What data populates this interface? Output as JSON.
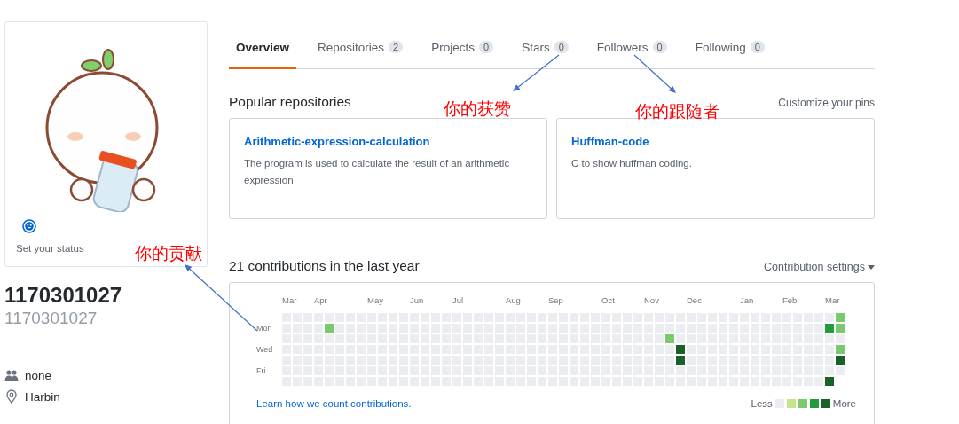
{
  "profile": {
    "status": "Set your status",
    "name": "1170301027",
    "login": "1170301027",
    "details": [
      {
        "kind": "organization",
        "text": "none"
      },
      {
        "kind": "location",
        "text": "Harbin"
      }
    ]
  },
  "tabs": [
    {
      "label": "Overview",
      "selected": true
    },
    {
      "label": "Repositories",
      "count": "2",
      "selected": false
    },
    {
      "label": "Projects",
      "count": "0",
      "selected": false
    },
    {
      "label": "Stars",
      "count": "0",
      "selected": false
    },
    {
      "label": "Followers",
      "count": "0",
      "selected": false
    },
    {
      "label": "Following",
      "count": "0",
      "selected": false
    }
  ],
  "popular": {
    "title": "Popular repositories",
    "action": "Customize your pins",
    "repos": [
      {
        "name": "Arithmetic-expression-calculation",
        "description": "The program is used to calculate the result of an arithmetic expression"
      },
      {
        "name": "Huffman-code",
        "description": "C to show huffman coding."
      }
    ]
  },
  "contributions": {
    "title": "21 contributions in the last year",
    "settings": "Contribution settings",
    "day_labels": [
      "Mon",
      "Wed",
      "Fri"
    ],
    "weeks": [
      {
        "month": "Mar",
        "days": [
          {
            "color": "#ebedf0"
          },
          {
            "color": "#ebedf0"
          },
          {
            "color": "#ebedf0"
          },
          {
            "color": "#ebedf0"
          },
          {
            "color": "#ebedf0"
          },
          {
            "color": "#ebedf0"
          },
          {
            "color": "#ebedf0"
          }
        ]
      },
      {
        "days": [
          {
            "color": "#ebedf0"
          },
          {
            "color": "#ebedf0"
          },
          {
            "color": "#ebedf0"
          },
          {
            "color": "#ebedf0"
          },
          {
            "color": "#ebedf0"
          },
          {
            "color": "#ebedf0"
          },
          {
            "color": "#ebedf0"
          }
        ]
      },
      {
        "days": [
          {
            "color": "#ebedf0"
          },
          {
            "color": "#ebedf0"
          },
          {
            "color": "#ebedf0"
          },
          {
            "color": "#ebedf0"
          },
          {
            "color": "#ebedf0"
          },
          {
            "color": "#ebedf0"
          },
          {
            "color": "#ebedf0"
          }
        ]
      },
      {
        "month": "Apr",
        "days": [
          {
            "color": "#ebedf0"
          },
          {
            "color": "#ebedf0"
          },
          {
            "color": "#ebedf0"
          },
          {
            "color": "#ebedf0"
          },
          {
            "color": "#ebedf0"
          },
          {
            "color": "#ebedf0"
          },
          {
            "color": "#ebedf0"
          }
        ]
      },
      {
        "days": [
          {
            "color": "#ebedf0"
          },
          {
            "color": "#7bc96f"
          },
          {
            "color": "#ebedf0"
          },
          {
            "color": "#ebedf0"
          },
          {
            "color": "#ebedf0"
          },
          {
            "color": "#ebedf0"
          },
          {
            "color": "#ebedf0"
          }
        ]
      },
      {
        "days": [
          {
            "color": "#ebedf0"
          },
          {
            "color": "#ebedf0"
          },
          {
            "color": "#ebedf0"
          },
          {
            "color": "#ebedf0"
          },
          {
            "color": "#ebedf0"
          },
          {
            "color": "#ebedf0"
          },
          {
            "color": "#ebedf0"
          }
        ]
      },
      {
        "days": [
          {
            "color": "#ebedf0"
          },
          {
            "color": "#ebedf0"
          },
          {
            "color": "#ebedf0"
          },
          {
            "color": "#ebedf0"
          },
          {
            "color": "#ebedf0"
          },
          {
            "color": "#ebedf0"
          },
          {
            "color": "#ebedf0"
          }
        ]
      },
      {
        "days": [
          {
            "color": "#ebedf0"
          },
          {
            "color": "#ebedf0"
          },
          {
            "color": "#ebedf0"
          },
          {
            "color": "#ebedf0"
          },
          {
            "color": "#ebedf0"
          },
          {
            "color": "#ebedf0"
          },
          {
            "color": "#ebedf0"
          }
        ]
      },
      {
        "month": "May",
        "days": [
          {
            "color": "#ebedf0"
          },
          {
            "color": "#ebedf0"
          },
          {
            "color": "#ebedf0"
          },
          {
            "color": "#ebedf0"
          },
          {
            "color": "#ebedf0"
          },
          {
            "color": "#ebedf0"
          },
          {
            "color": "#ebedf0"
          }
        ]
      },
      {
        "days": [
          {
            "color": "#ebedf0"
          },
          {
            "color": "#ebedf0"
          },
          {
            "color": "#ebedf0"
          },
          {
            "color": "#ebedf0"
          },
          {
            "color": "#ebedf0"
          },
          {
            "color": "#ebedf0"
          },
          {
            "color": "#ebedf0"
          }
        ]
      },
      {
        "days": [
          {
            "color": "#ebedf0"
          },
          {
            "color": "#ebedf0"
          },
          {
            "color": "#ebedf0"
          },
          {
            "color": "#ebedf0"
          },
          {
            "color": "#ebedf0"
          },
          {
            "color": "#ebedf0"
          },
          {
            "color": "#ebedf0"
          }
        ]
      },
      {
        "days": [
          {
            "color": "#ebedf0"
          },
          {
            "color": "#ebedf0"
          },
          {
            "color": "#ebedf0"
          },
          {
            "color": "#ebedf0"
          },
          {
            "color": "#ebedf0"
          },
          {
            "color": "#ebedf0"
          },
          {
            "color": "#ebedf0"
          }
        ]
      },
      {
        "month": "Jun",
        "days": [
          {
            "color": "#ebedf0"
          },
          {
            "color": "#ebedf0"
          },
          {
            "color": "#ebedf0"
          },
          {
            "color": "#ebedf0"
          },
          {
            "color": "#ebedf0"
          },
          {
            "color": "#ebedf0"
          },
          {
            "color": "#ebedf0"
          }
        ]
      },
      {
        "days": [
          {
            "color": "#ebedf0"
          },
          {
            "color": "#ebedf0"
          },
          {
            "color": "#ebedf0"
          },
          {
            "color": "#ebedf0"
          },
          {
            "color": "#ebedf0"
          },
          {
            "color": "#ebedf0"
          },
          {
            "color": "#ebedf0"
          }
        ]
      },
      {
        "days": [
          {
            "color": "#ebedf0"
          },
          {
            "color": "#ebedf0"
          },
          {
            "color": "#ebedf0"
          },
          {
            "color": "#ebedf0"
          },
          {
            "color": "#ebedf0"
          },
          {
            "color": "#ebedf0"
          },
          {
            "color": "#ebedf0"
          }
        ]
      },
      {
        "days": [
          {
            "color": "#ebedf0"
          },
          {
            "color": "#ebedf0"
          },
          {
            "color": "#ebedf0"
          },
          {
            "color": "#ebedf0"
          },
          {
            "color": "#ebedf0"
          },
          {
            "color": "#ebedf0"
          },
          {
            "color": "#ebedf0"
          }
        ]
      },
      {
        "month": "Jul",
        "days": [
          {
            "color": "#ebedf0"
          },
          {
            "color": "#ebedf0"
          },
          {
            "color": "#ebedf0"
          },
          {
            "color": "#ebedf0"
          },
          {
            "color": "#ebedf0"
          },
          {
            "color": "#ebedf0"
          },
          {
            "color": "#ebedf0"
          }
        ]
      },
      {
        "days": [
          {
            "color": "#ebedf0"
          },
          {
            "color": "#ebedf0"
          },
          {
            "color": "#ebedf0"
          },
          {
            "color": "#ebedf0"
          },
          {
            "color": "#ebedf0"
          },
          {
            "color": "#ebedf0"
          },
          {
            "color": "#ebedf0"
          }
        ]
      },
      {
        "days": [
          {
            "color": "#ebedf0"
          },
          {
            "color": "#ebedf0"
          },
          {
            "color": "#ebedf0"
          },
          {
            "color": "#ebedf0"
          },
          {
            "color": "#ebedf0"
          },
          {
            "color": "#ebedf0"
          },
          {
            "color": "#ebedf0"
          }
        ]
      },
      {
        "days": [
          {
            "color": "#ebedf0"
          },
          {
            "color": "#ebedf0"
          },
          {
            "color": "#ebedf0"
          },
          {
            "color": "#ebedf0"
          },
          {
            "color": "#ebedf0"
          },
          {
            "color": "#ebedf0"
          },
          {
            "color": "#ebedf0"
          }
        ]
      },
      {
        "days": [
          {
            "color": "#ebedf0"
          },
          {
            "color": "#ebedf0"
          },
          {
            "color": "#ebedf0"
          },
          {
            "color": "#ebedf0"
          },
          {
            "color": "#ebedf0"
          },
          {
            "color": "#ebedf0"
          },
          {
            "color": "#ebedf0"
          }
        ]
      },
      {
        "month": "Aug",
        "days": [
          {
            "color": "#ebedf0"
          },
          {
            "color": "#ebedf0"
          },
          {
            "color": "#ebedf0"
          },
          {
            "color": "#ebedf0"
          },
          {
            "color": "#ebedf0"
          },
          {
            "color": "#ebedf0"
          },
          {
            "color": "#ebedf0"
          }
        ]
      },
      {
        "days": [
          {
            "color": "#ebedf0"
          },
          {
            "color": "#ebedf0"
          },
          {
            "color": "#ebedf0"
          },
          {
            "color": "#ebedf0"
          },
          {
            "color": "#ebedf0"
          },
          {
            "color": "#ebedf0"
          },
          {
            "color": "#ebedf0"
          }
        ]
      },
      {
        "days": [
          {
            "color": "#ebedf0"
          },
          {
            "color": "#ebedf0"
          },
          {
            "color": "#ebedf0"
          },
          {
            "color": "#ebedf0"
          },
          {
            "color": "#ebedf0"
          },
          {
            "color": "#ebedf0"
          },
          {
            "color": "#ebedf0"
          }
        ]
      },
      {
        "days": [
          {
            "color": "#ebedf0"
          },
          {
            "color": "#ebedf0"
          },
          {
            "color": "#ebedf0"
          },
          {
            "color": "#ebedf0"
          },
          {
            "color": "#ebedf0"
          },
          {
            "color": "#ebedf0"
          },
          {
            "color": "#ebedf0"
          }
        ]
      },
      {
        "month": "Sep",
        "days": [
          {
            "color": "#ebedf0"
          },
          {
            "color": "#ebedf0"
          },
          {
            "color": "#ebedf0"
          },
          {
            "color": "#ebedf0"
          },
          {
            "color": "#ebedf0"
          },
          {
            "color": "#ebedf0"
          },
          {
            "color": "#ebedf0"
          }
        ]
      },
      {
        "days": [
          {
            "color": "#ebedf0"
          },
          {
            "color": "#ebedf0"
          },
          {
            "color": "#ebedf0"
          },
          {
            "color": "#ebedf0"
          },
          {
            "color": "#ebedf0"
          },
          {
            "color": "#ebedf0"
          },
          {
            "color": "#ebedf0"
          }
        ]
      },
      {
        "days": [
          {
            "color": "#ebedf0"
          },
          {
            "color": "#ebedf0"
          },
          {
            "color": "#ebedf0"
          },
          {
            "color": "#ebedf0"
          },
          {
            "color": "#ebedf0"
          },
          {
            "color": "#ebedf0"
          },
          {
            "color": "#ebedf0"
          }
        ]
      },
      {
        "days": [
          {
            "color": "#ebedf0"
          },
          {
            "color": "#ebedf0"
          },
          {
            "color": "#ebedf0"
          },
          {
            "color": "#ebedf0"
          },
          {
            "color": "#ebedf0"
          },
          {
            "color": "#ebedf0"
          },
          {
            "color": "#ebedf0"
          }
        ]
      },
      {
        "days": [
          {
            "color": "#ebedf0"
          },
          {
            "color": "#ebedf0"
          },
          {
            "color": "#ebedf0"
          },
          {
            "color": "#ebedf0"
          },
          {
            "color": "#ebedf0"
          },
          {
            "color": "#ebedf0"
          },
          {
            "color": "#ebedf0"
          }
        ]
      },
      {
        "month": "Oct",
        "days": [
          {
            "color": "#ebedf0"
          },
          {
            "color": "#ebedf0"
          },
          {
            "color": "#ebedf0"
          },
          {
            "color": "#ebedf0"
          },
          {
            "color": "#ebedf0"
          },
          {
            "color": "#ebedf0"
          },
          {
            "color": "#ebedf0"
          }
        ]
      },
      {
        "days": [
          {
            "color": "#ebedf0"
          },
          {
            "color": "#ebedf0"
          },
          {
            "color": "#ebedf0"
          },
          {
            "color": "#ebedf0"
          },
          {
            "color": "#ebedf0"
          },
          {
            "color": "#ebedf0"
          },
          {
            "color": "#ebedf0"
          }
        ]
      },
      {
        "days": [
          {
            "color": "#ebedf0"
          },
          {
            "color": "#ebedf0"
          },
          {
            "color": "#ebedf0"
          },
          {
            "color": "#ebedf0"
          },
          {
            "color": "#ebedf0"
          },
          {
            "color": "#ebedf0"
          },
          {
            "color": "#ebedf0"
          }
        ]
      },
      {
        "days": [
          {
            "color": "#ebedf0"
          },
          {
            "color": "#ebedf0"
          },
          {
            "color": "#ebedf0"
          },
          {
            "color": "#ebedf0"
          },
          {
            "color": "#ebedf0"
          },
          {
            "color": "#ebedf0"
          },
          {
            "color": "#ebedf0"
          }
        ]
      },
      {
        "month": "Nov",
        "days": [
          {
            "color": "#ebedf0"
          },
          {
            "color": "#ebedf0"
          },
          {
            "color": "#ebedf0"
          },
          {
            "color": "#ebedf0"
          },
          {
            "color": "#ebedf0"
          },
          {
            "color": "#ebedf0"
          },
          {
            "color": "#ebedf0"
          }
        ]
      },
      {
        "days": [
          {
            "color": "#ebedf0"
          },
          {
            "color": "#ebedf0"
          },
          {
            "color": "#ebedf0"
          },
          {
            "color": "#ebedf0"
          },
          {
            "color": "#ebedf0"
          },
          {
            "color": "#ebedf0"
          },
          {
            "color": "#ebedf0"
          }
        ]
      },
      {
        "days": [
          {
            "color": "#ebedf0"
          },
          {
            "color": "#ebedf0"
          },
          {
            "color": "#7bc96f"
          },
          {
            "color": "#ebedf0"
          },
          {
            "color": "#ebedf0"
          },
          {
            "color": "#ebedf0"
          },
          {
            "color": "#ebedf0"
          }
        ]
      },
      {
        "days": [
          {
            "color": "#ebedf0"
          },
          {
            "color": "#ebedf0"
          },
          {
            "color": "#ebedf0"
          },
          {
            "color": "#196127"
          },
          {
            "color": "#196127"
          },
          {
            "color": "#ebedf0"
          },
          {
            "color": "#ebedf0"
          }
        ]
      },
      {
        "month": "Dec",
        "days": [
          {
            "color": "#ebedf0"
          },
          {
            "color": "#ebedf0"
          },
          {
            "color": "#ebedf0"
          },
          {
            "color": "#ebedf0"
          },
          {
            "color": "#ebedf0"
          },
          {
            "color": "#ebedf0"
          },
          {
            "color": "#ebedf0"
          }
        ]
      },
      {
        "days": [
          {
            "color": "#ebedf0"
          },
          {
            "color": "#ebedf0"
          },
          {
            "color": "#ebedf0"
          },
          {
            "color": "#ebedf0"
          },
          {
            "color": "#ebedf0"
          },
          {
            "color": "#ebedf0"
          },
          {
            "color": "#ebedf0"
          }
        ]
      },
      {
        "days": [
          {
            "color": "#ebedf0"
          },
          {
            "color": "#ebedf0"
          },
          {
            "color": "#ebedf0"
          },
          {
            "color": "#ebedf0"
          },
          {
            "color": "#ebedf0"
          },
          {
            "color": "#ebedf0"
          },
          {
            "color": "#ebedf0"
          }
        ]
      },
      {
        "days": [
          {
            "color": "#ebedf0"
          },
          {
            "color": "#ebedf0"
          },
          {
            "color": "#ebedf0"
          },
          {
            "color": "#ebedf0"
          },
          {
            "color": "#ebedf0"
          },
          {
            "color": "#ebedf0"
          },
          {
            "color": "#ebedf0"
          }
        ]
      },
      {
        "days": [
          {
            "color": "#ebedf0"
          },
          {
            "color": "#ebedf0"
          },
          {
            "color": "#ebedf0"
          },
          {
            "color": "#ebedf0"
          },
          {
            "color": "#ebedf0"
          },
          {
            "color": "#ebedf0"
          },
          {
            "color": "#ebedf0"
          }
        ]
      },
      {
        "month": "Jan",
        "days": [
          {
            "color": "#ebedf0"
          },
          {
            "color": "#ebedf0"
          },
          {
            "color": "#ebedf0"
          },
          {
            "color": "#ebedf0"
          },
          {
            "color": "#ebedf0"
          },
          {
            "color": "#ebedf0"
          },
          {
            "color": "#ebedf0"
          }
        ]
      },
      {
        "days": [
          {
            "color": "#ebedf0"
          },
          {
            "color": "#ebedf0"
          },
          {
            "color": "#ebedf0"
          },
          {
            "color": "#ebedf0"
          },
          {
            "color": "#ebedf0"
          },
          {
            "color": "#ebedf0"
          },
          {
            "color": "#ebedf0"
          }
        ]
      },
      {
        "days": [
          {
            "color": "#ebedf0"
          },
          {
            "color": "#ebedf0"
          },
          {
            "color": "#ebedf0"
          },
          {
            "color": "#ebedf0"
          },
          {
            "color": "#ebedf0"
          },
          {
            "color": "#ebedf0"
          },
          {
            "color": "#ebedf0"
          }
        ]
      },
      {
        "days": [
          {
            "color": "#ebedf0"
          },
          {
            "color": "#ebedf0"
          },
          {
            "color": "#ebedf0"
          },
          {
            "color": "#ebedf0"
          },
          {
            "color": "#ebedf0"
          },
          {
            "color": "#ebedf0"
          },
          {
            "color": "#ebedf0"
          }
        ]
      },
      {
        "month": "Feb",
        "days": [
          {
            "color": "#ebedf0"
          },
          {
            "color": "#ebedf0"
          },
          {
            "color": "#ebedf0"
          },
          {
            "color": "#ebedf0"
          },
          {
            "color": "#ebedf0"
          },
          {
            "color": "#ebedf0"
          },
          {
            "color": "#ebedf0"
          }
        ]
      },
      {
        "days": [
          {
            "color": "#ebedf0"
          },
          {
            "color": "#ebedf0"
          },
          {
            "color": "#ebedf0"
          },
          {
            "color": "#ebedf0"
          },
          {
            "color": "#ebedf0"
          },
          {
            "color": "#ebedf0"
          },
          {
            "color": "#ebedf0"
          }
        ]
      },
      {
        "days": [
          {
            "color": "#ebedf0"
          },
          {
            "color": "#ebedf0"
          },
          {
            "color": "#ebedf0"
          },
          {
            "color": "#ebedf0"
          },
          {
            "color": "#ebedf0"
          },
          {
            "color": "#ebedf0"
          },
          {
            "color": "#ebedf0"
          }
        ]
      },
      {
        "days": [
          {
            "color": "#ebedf0"
          },
          {
            "color": "#ebedf0"
          },
          {
            "color": "#ebedf0"
          },
          {
            "color": "#ebedf0"
          },
          {
            "color": "#ebedf0"
          },
          {
            "color": "#ebedf0"
          },
          {
            "color": "#ebedf0"
          }
        ]
      },
      {
        "month": "Mar",
        "days": [
          {
            "color": "#ebedf0"
          },
          {
            "color": "#239a3b"
          },
          {
            "color": "#ebedf0"
          },
          {
            "color": "#ebedf0"
          },
          {
            "color": "#ebedf0"
          },
          {
            "color": "#ebedf0"
          },
          {
            "color": "#196127"
          }
        ]
      },
      {
        "days": [
          {
            "color": "#7bc96f"
          },
          {
            "color": "#7bc96f"
          },
          {
            "color": "#ebedf0"
          },
          {
            "color": "#7bc96f"
          },
          {
            "color": "#196127"
          },
          {
            "color": "#ebedf0"
          }
        ]
      }
    ],
    "learn_link": "Learn how we count contributions.",
    "legend": {
      "less": "Less",
      "more": "More"
    }
  },
  "annotations": [
    {
      "text": "你的获赞"
    },
    {
      "text": "你的跟随者"
    },
    {
      "text": "你的贡献"
    }
  ]
}
